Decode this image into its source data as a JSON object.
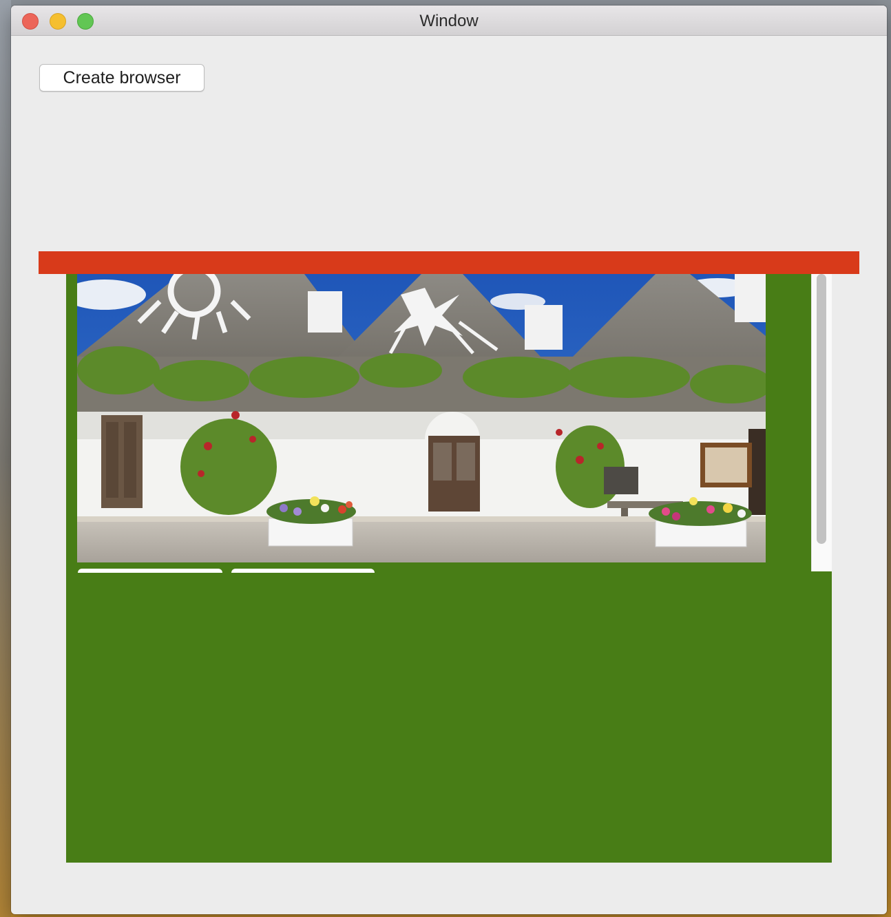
{
  "window": {
    "title": "Window"
  },
  "toolbar": {
    "create_browser_label": "Create browser"
  },
  "colors": {
    "top_bar": "#d83a1a",
    "panel": "#487d16"
  },
  "image": {
    "subject": "trulli-houses-photo"
  }
}
